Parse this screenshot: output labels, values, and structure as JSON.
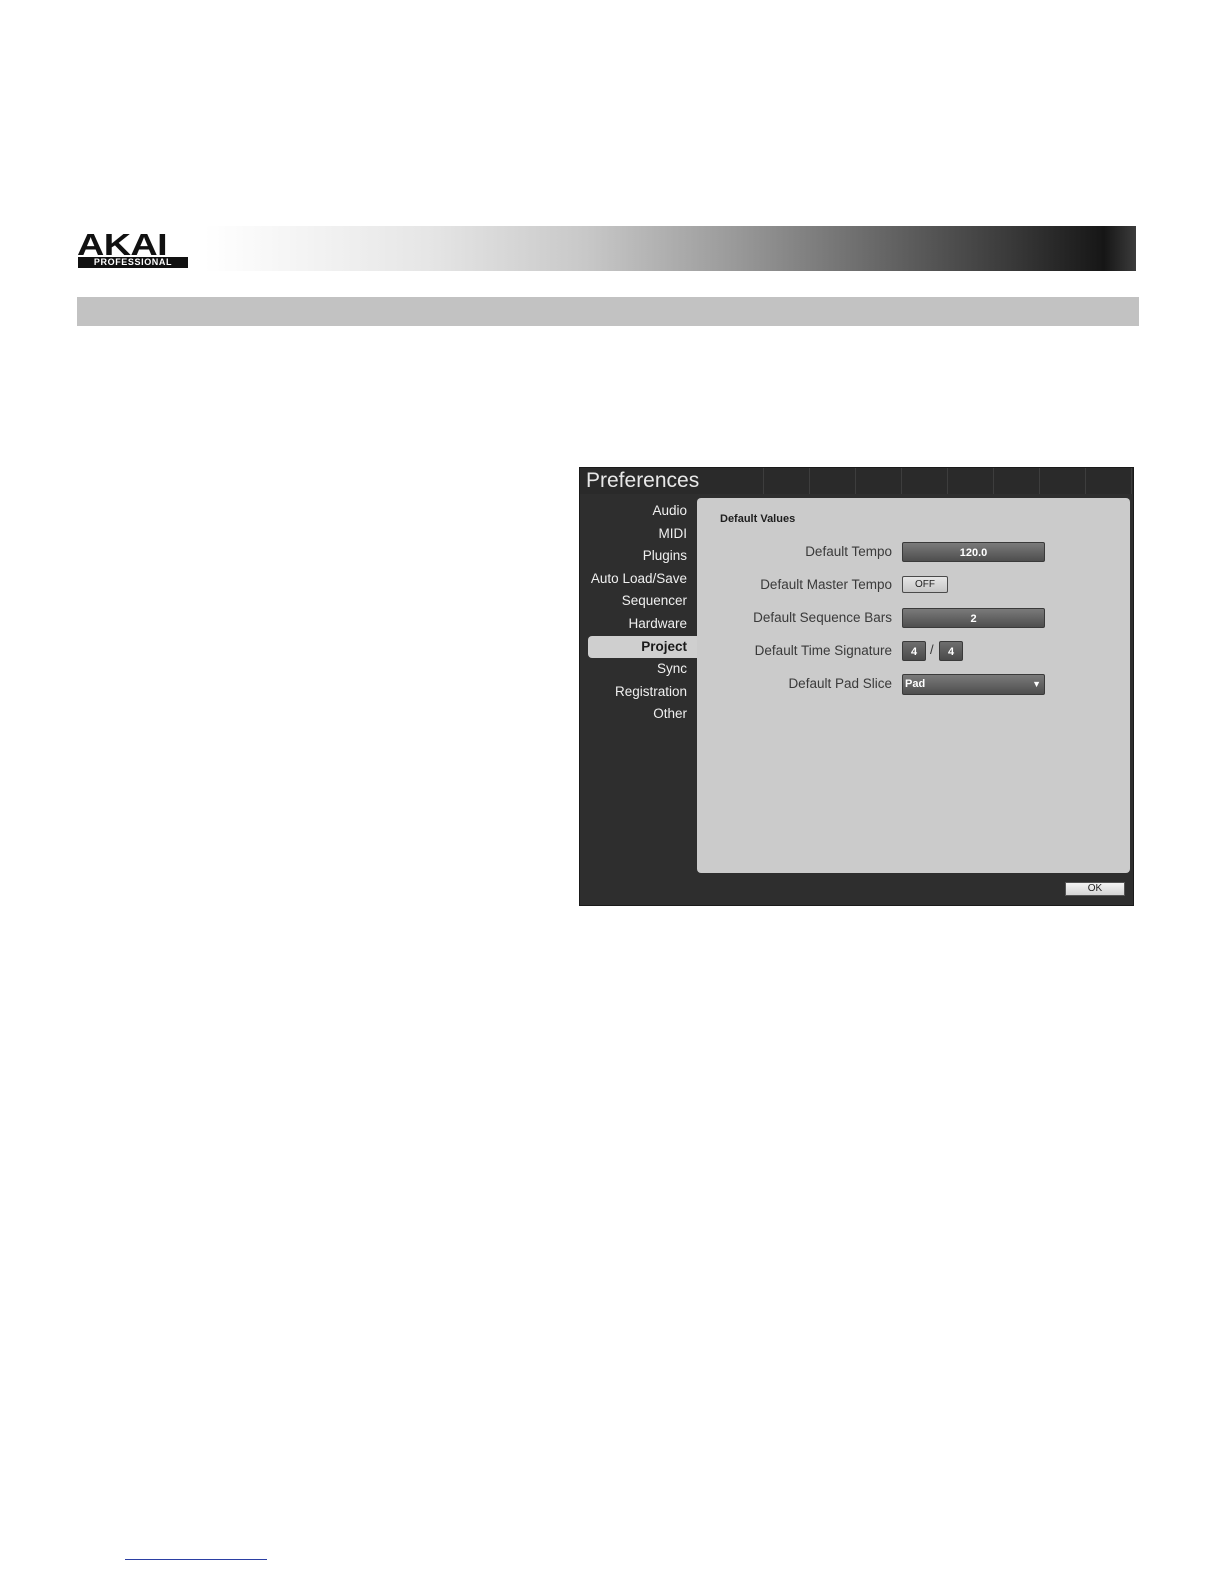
{
  "brand": {
    "logo_text": "AKAI",
    "logo_sub": "PROFESSIONAL"
  },
  "preferences": {
    "title": "Preferences",
    "nav_items": [
      {
        "label": "Audio",
        "active": false
      },
      {
        "label": "MIDI",
        "active": false
      },
      {
        "label": "Plugins",
        "active": false
      },
      {
        "label": "Auto Load/Save",
        "active": false
      },
      {
        "label": "Sequencer",
        "active": false
      },
      {
        "label": "Hardware",
        "active": false
      },
      {
        "label": "Project",
        "active": true
      },
      {
        "label": "Sync",
        "active": false
      },
      {
        "label": "Registration",
        "active": false
      },
      {
        "label": "Other",
        "active": false
      }
    ],
    "panel": {
      "group_title": "Default Values",
      "tempo": {
        "label": "Default Tempo",
        "value": "120.0"
      },
      "master_tempo": {
        "label": "Default Master Tempo",
        "value": "OFF"
      },
      "sequence_bars": {
        "label": "Default Sequence Bars",
        "value": "2"
      },
      "time_signature": {
        "label": "Default Time Signature",
        "numerator": "4",
        "separator": "/",
        "denominator": "4"
      },
      "pad_slice": {
        "label": "Default Pad Slice",
        "value": "Pad",
        "arrow": "▼"
      }
    },
    "ok_label": "OK"
  }
}
